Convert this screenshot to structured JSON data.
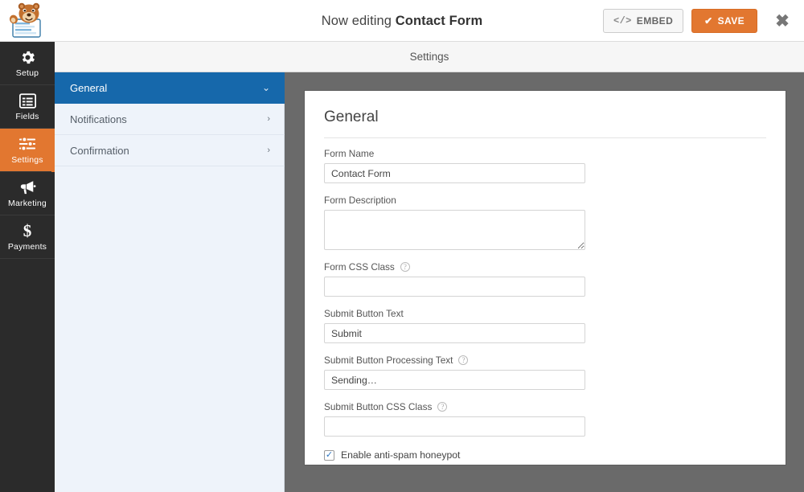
{
  "header": {
    "logo_icon": "wpforms-bear-logo",
    "editing_prefix": "Now editing ",
    "form_title": "Contact Form",
    "embed_label": "EMBED",
    "embed_icon": "code-brackets-icon",
    "embed_glyph": "</>",
    "save_label": "SAVE",
    "save_icon": "check-icon",
    "save_glyph": "✔",
    "close_icon": "close-icon",
    "close_glyph": "✖",
    "accent_orange": "#e27730",
    "accent_blue": "#1668ab"
  },
  "sidebar": {
    "items": [
      {
        "label": "Setup",
        "icon": "gear-icon",
        "active": false
      },
      {
        "label": "Fields",
        "icon": "form-fields-icon",
        "active": false
      },
      {
        "label": "Settings",
        "icon": "sliders-icon",
        "active": true
      },
      {
        "label": "Marketing",
        "icon": "megaphone-icon",
        "active": false
      },
      {
        "label": "Payments",
        "icon": "dollar-sign-icon",
        "active": false
      }
    ]
  },
  "strip": {
    "title": "Settings"
  },
  "panel_list": {
    "items": [
      {
        "label": "General",
        "chevron": "⌄",
        "chevron_icon": "chevron-down-icon",
        "active": true
      },
      {
        "label": "Notifications",
        "chevron": "›",
        "chevron_icon": "chevron-right-icon",
        "active": false
      },
      {
        "label": "Confirmation",
        "chevron": "›",
        "chevron_icon": "chevron-right-icon",
        "active": false
      }
    ]
  },
  "general": {
    "title": "General",
    "form_name": {
      "label": "Form Name",
      "value": "Contact Form",
      "placeholder": ""
    },
    "form_description": {
      "label": "Form Description",
      "value": "",
      "placeholder": ""
    },
    "form_css_class": {
      "label": "Form CSS Class",
      "value": "",
      "placeholder": "",
      "help_icon": "help-circle-icon",
      "help_glyph": "?"
    },
    "submit_button_text": {
      "label": "Submit Button Text",
      "value": "Submit",
      "placeholder": ""
    },
    "submit_button_processing_text": {
      "label": "Submit Button Processing Text",
      "value": "Sending…",
      "placeholder": "",
      "help_icon": "help-circle-icon",
      "help_glyph": "?"
    },
    "submit_button_css_class": {
      "label": "Submit Button CSS Class",
      "value": "",
      "placeholder": "",
      "help_icon": "help-circle-icon",
      "help_glyph": "?"
    },
    "honeypot": {
      "label": "Enable anti-spam honeypot",
      "checked": true,
      "check_glyph": "✓"
    }
  }
}
